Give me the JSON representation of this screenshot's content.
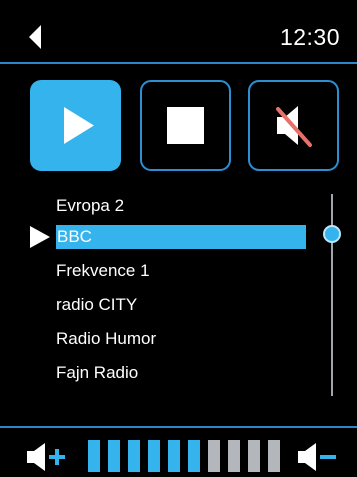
{
  "header": {
    "back_icon": "back-arrow-icon",
    "time": "12:30"
  },
  "controls": [
    {
      "name": "play",
      "icon": "play-icon",
      "active": true
    },
    {
      "name": "stop",
      "icon": "stop-icon",
      "active": false
    },
    {
      "name": "mute",
      "icon": "speaker-muted-icon",
      "active": false
    }
  ],
  "stations": [
    {
      "label": "Evropa 2"
    },
    {
      "label": "BBC"
    },
    {
      "label": "Frekvence 1"
    },
    {
      "label": "radio CITY"
    },
    {
      "label": "Radio Humor"
    },
    {
      "label": "Fajn Radio"
    }
  ],
  "selected_station_index": 1,
  "volume": {
    "segments_total": 10,
    "segments_filled": 6,
    "up_icon": "volume-up-icon",
    "down_icon": "volume-down-icon"
  },
  "colors": {
    "accent": "#34b3ec",
    "border": "#2e8fd0",
    "inactive_segment": "#b3b6ba",
    "mute_slash": "#e8706a",
    "background": "#000000"
  }
}
